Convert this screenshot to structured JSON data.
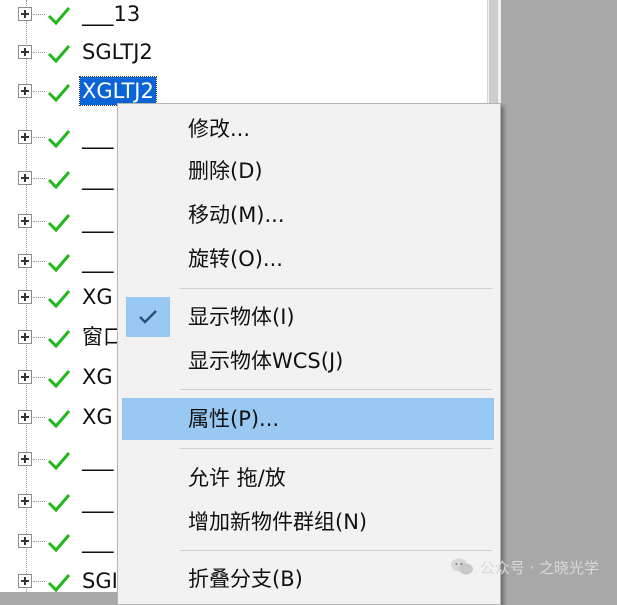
{
  "tree": {
    "items": [
      {
        "label": "___13"
      },
      {
        "label": "SGLTJ2"
      },
      {
        "label": "XGLTJ2",
        "selected": true
      },
      {
        "label": "___"
      },
      {
        "label": "___"
      },
      {
        "label": "___"
      },
      {
        "label": "___"
      },
      {
        "label": "XG"
      },
      {
        "label": "窗口"
      },
      {
        "label": "XG"
      },
      {
        "label": "XG"
      },
      {
        "label": "___"
      },
      {
        "label": "___"
      },
      {
        "label": "___"
      },
      {
        "label": "SGI"
      }
    ]
  },
  "context_menu": {
    "items": [
      {
        "label": "修改..."
      },
      {
        "label": "删除(D)"
      },
      {
        "label": "移动(M)..."
      },
      {
        "label": "旋转(O)..."
      },
      {
        "label": "显示物体(I)",
        "checked": true
      },
      {
        "label": "显示物体WCS(J)"
      },
      {
        "label": "属性(P)...",
        "highlighted": true
      },
      {
        "label": "允许 拖/放"
      },
      {
        "label": "增加新物件群组(N)"
      },
      {
        "label": "折叠分支(B)"
      }
    ]
  },
  "watermark": {
    "text": "公众号 · 之晓光学",
    "icon": "wechat-icon"
  },
  "colors": {
    "selection": "#0a64d6",
    "menu_highlight": "#99c9f3",
    "check": "#21b81c"
  }
}
